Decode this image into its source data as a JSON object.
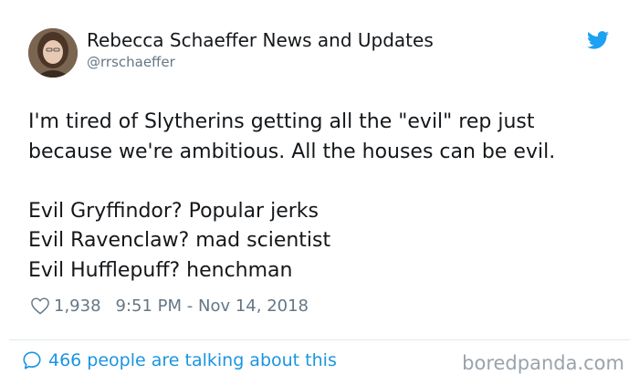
{
  "author": {
    "name": "Rebecca Schaeffer News and Updates",
    "handle": "@rrschaeffer"
  },
  "tweet": {
    "text": "I'm tired of Slytherins getting all the \"evil\" rep just\nbecause we're ambitious. All the houses can be evil.\n\nEvil Gryffindor? Popular jerks\nEvil Ravenclaw? mad scientist\nEvil Hufflepuff? henchman",
    "likes": "1,938",
    "timestamp": "9:51 PM - Nov 14, 2018"
  },
  "footer": {
    "talking": "466 people are talking about this",
    "watermark": "boredpanda.com"
  },
  "colors": {
    "twitter_blue": "#1da1f2",
    "link_blue": "#1b95e0",
    "muted_gray": "#657786"
  },
  "icons": {
    "bird": "twitter-bird-icon",
    "like": "heart-icon",
    "reply": "speech-bubble-icon"
  }
}
